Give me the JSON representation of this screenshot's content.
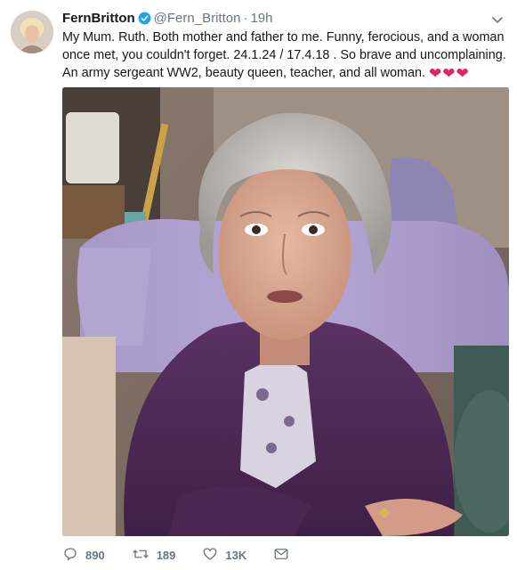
{
  "tweet": {
    "display_name": "FernBritton",
    "handle": "@Fern_Britton",
    "time": "19h",
    "text": "My Mum. Ruth. Both mother and father to me. Funny, ferocious, and a woman once met, you couldn't forget. 24.1.24 / 17.4.18 . So brave and uncomplaining. An army sergeant WW2, beauty queen, teacher, and all woman.",
    "emoji": [
      "❤",
      "❤",
      "❤"
    ]
  },
  "actions": {
    "replies": "890",
    "retweets": "189",
    "likes": "13K"
  },
  "colors": {
    "text": "#14171a",
    "muted": "#657786",
    "verified": "#1da1f2",
    "heart": "#e0245e"
  },
  "icons": {
    "verified": "verified-badge-icon",
    "caret": "chevron-down-icon",
    "reply": "reply-icon",
    "retweet": "retweet-icon",
    "like": "heart-icon",
    "message": "envelope-icon"
  }
}
